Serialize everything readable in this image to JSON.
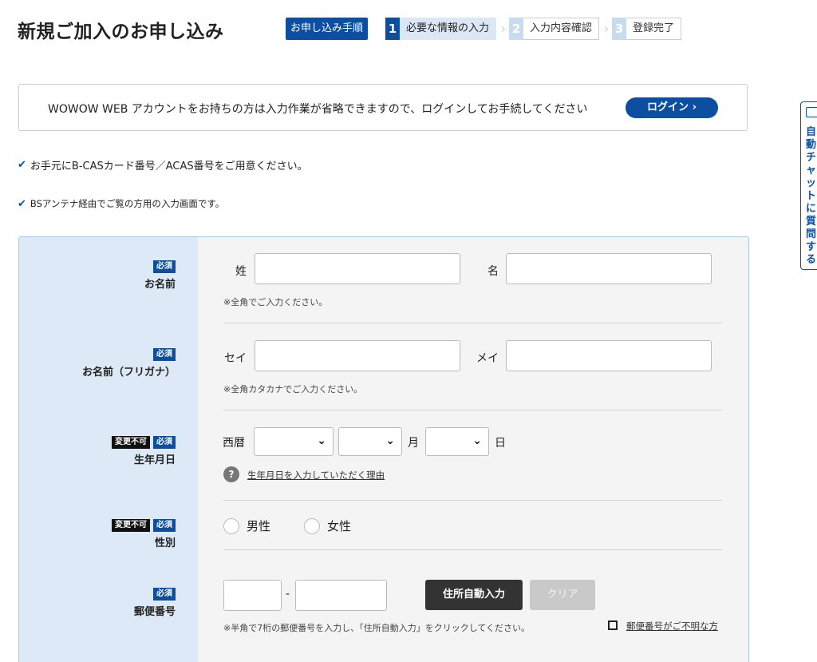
{
  "header": {
    "title": "新規ご加入のお申し込み",
    "steps_label": "お申し込み手順",
    "steps": [
      {
        "num": "1",
        "label": "必要な情報の入力"
      },
      {
        "num": "2",
        "label": "入力内容確認"
      },
      {
        "num": "3",
        "label": "登録完了"
      }
    ]
  },
  "login": {
    "message": "WOWOW WEB アカウントをお持ちの方は入力作業が省略できますので、ログインしてお手続してください",
    "button_label": "ログイン ›"
  },
  "notes": [
    "お手元にB-CASカード番号／ACAS番号をご用意ください。",
    "BSアンテナ経由でご覧の方用の入力画面です。"
  ],
  "side_tab": {
    "label": "自動チャットに質問する"
  },
  "form": {
    "required_badge": "必須",
    "fixed_badge": "変更不可",
    "name": {
      "label": "お名前",
      "last_label": "姓",
      "first_label": "名",
      "last_value": "",
      "first_value": "",
      "hint": "※全角でご入力ください。"
    },
    "kana": {
      "label": "お名前（フリガナ）",
      "last_label": "セイ",
      "first_label": "メイ",
      "last_value": "",
      "first_value": "",
      "hint": "※全角カタカナでご入力ください。"
    },
    "birthdate": {
      "label": "生年月日",
      "era_label": "西暦",
      "month_label": "月",
      "day_label": "日",
      "year_value": "",
      "month_value": "",
      "day_value": "",
      "help_link": "生年月日を入力していただく理由"
    },
    "gender": {
      "label": "性別",
      "options": [
        "男性",
        "女性"
      ]
    },
    "postal": {
      "label": "郵便番号",
      "separator": "-",
      "part1_value": "",
      "part2_value": "",
      "auto_button": "住所自動入力",
      "clear_button": "クリア",
      "hint": "※半角で7桁の郵便番号を入力し、「住所自動入力」をクリックしてください。",
      "unknown_link": "郵便番号がご不明な方"
    }
  },
  "colors": {
    "brand": "#0b4ea2",
    "label_bg": "#dde9f6",
    "form_bg": "#f4f4f4"
  }
}
